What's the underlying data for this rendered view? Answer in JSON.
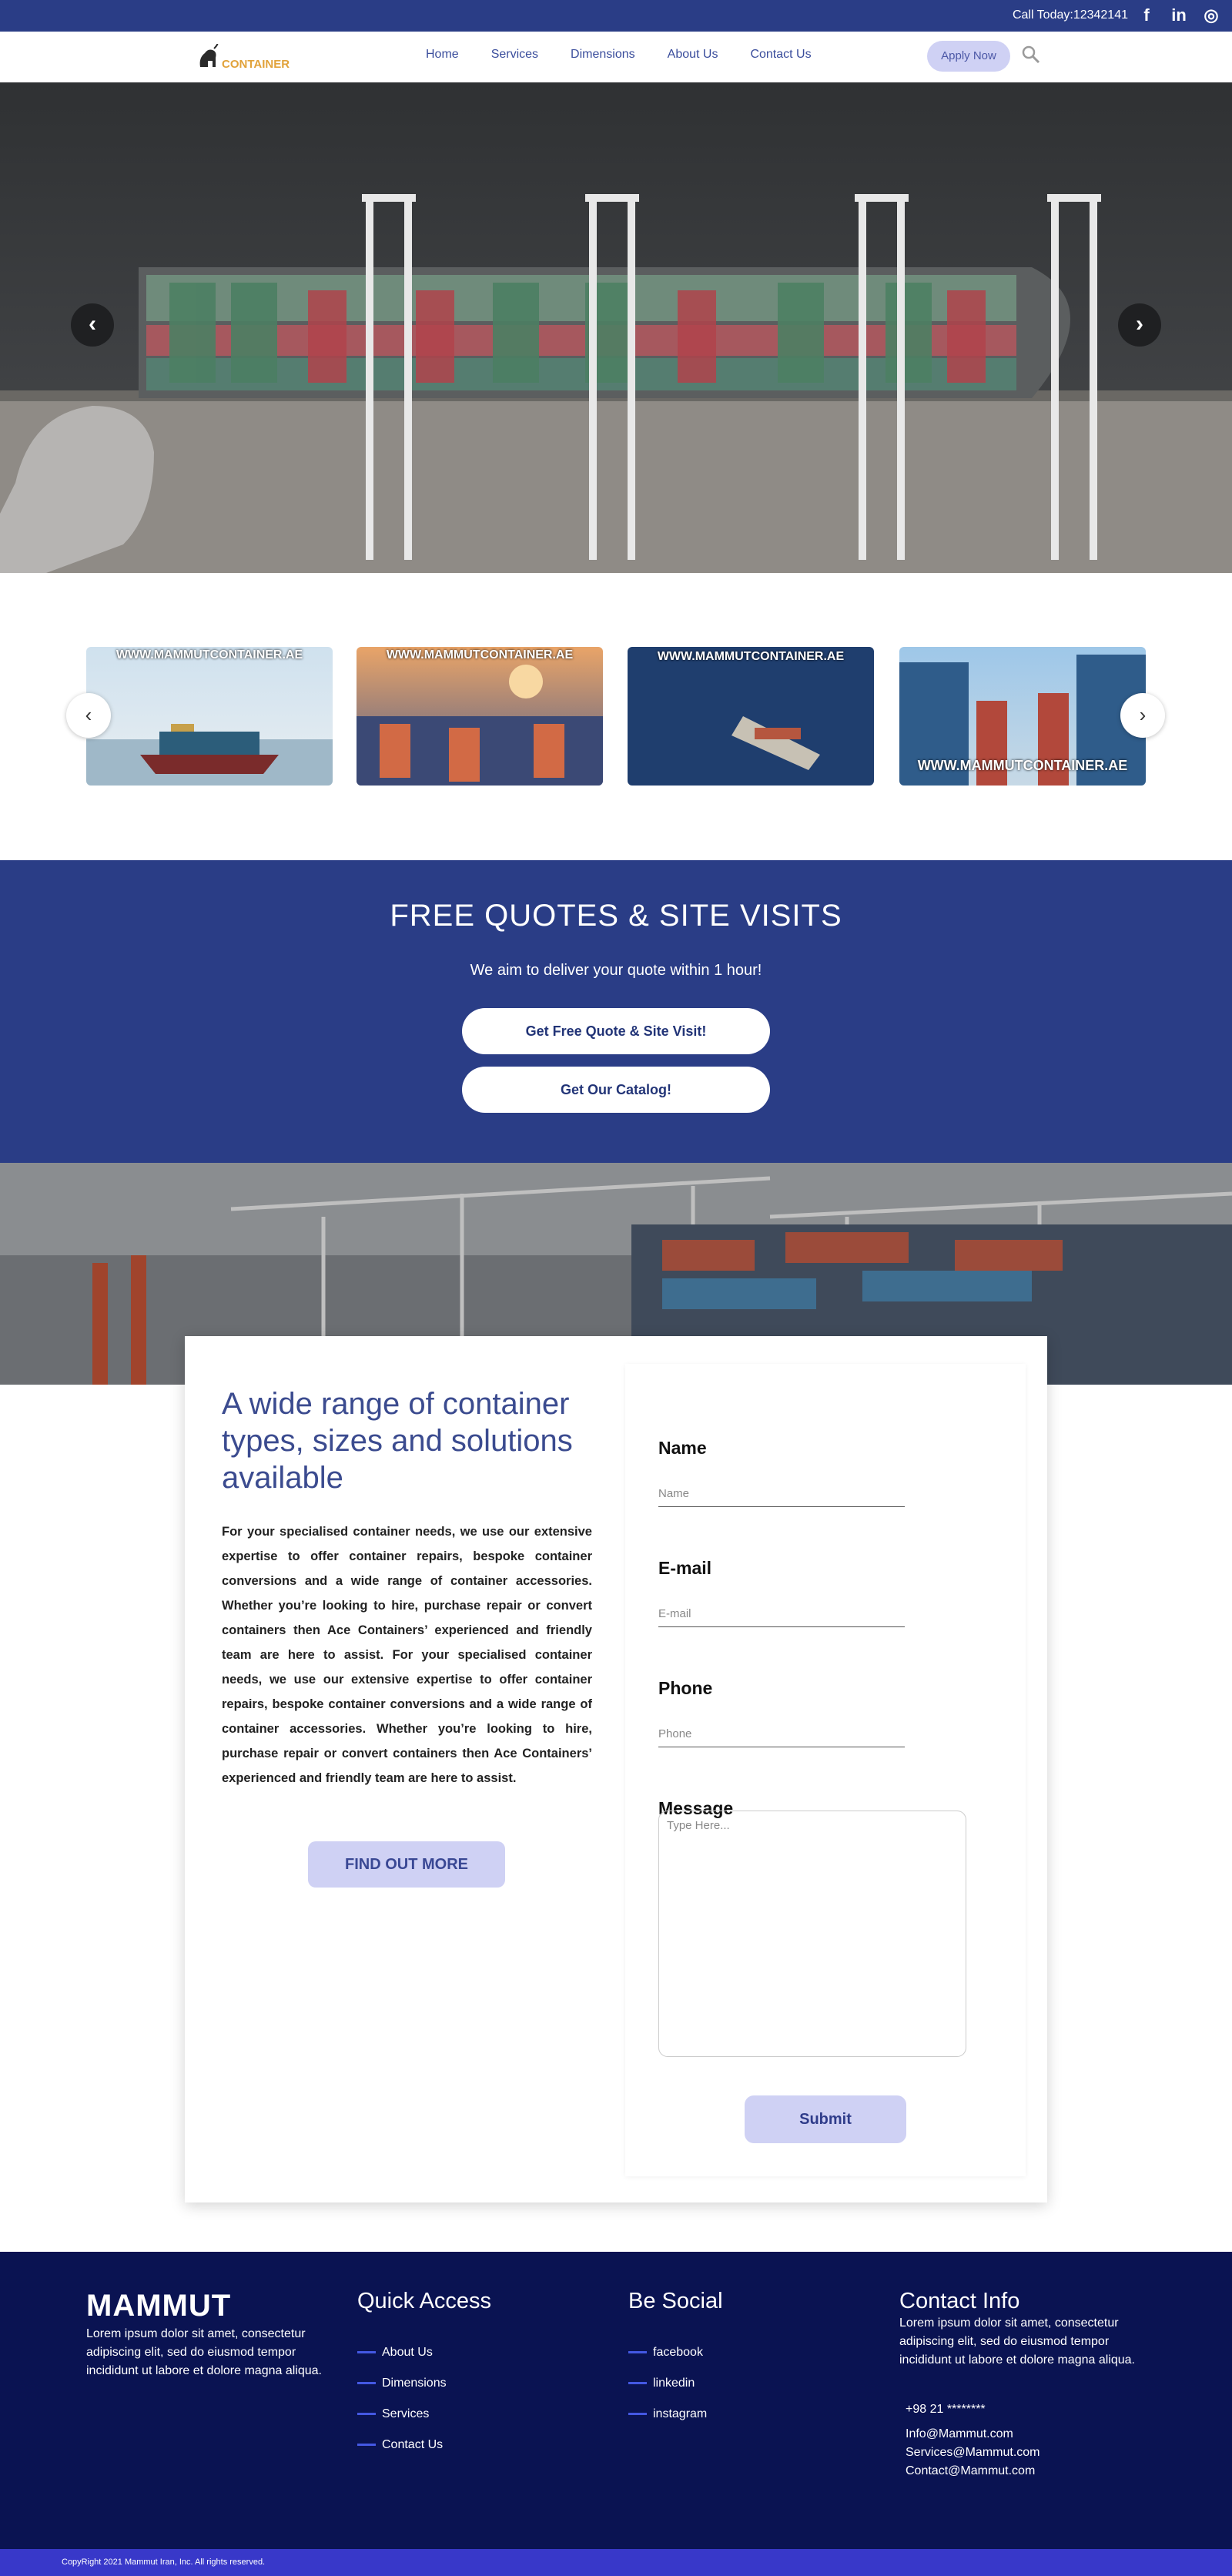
{
  "topbar": {
    "call_text": "Call Today:12342141",
    "social": [
      {
        "icon": "facebook-icon",
        "glyph": "f"
      },
      {
        "icon": "linkedin-icon",
        "glyph": "in"
      },
      {
        "icon": "instagram-icon",
        "glyph": "◎"
      }
    ]
  },
  "nav": {
    "logo_text": "CONTAINER",
    "items": [
      "Home",
      "Services",
      "Dimensions",
      "About Us",
      "Contact Us"
    ],
    "apply_label": "Apply Now",
    "search_icon": "search-icon"
  },
  "hero": {
    "prev_glyph": "‹",
    "next_glyph": "›"
  },
  "thumbs": {
    "prev_glyph": "‹",
    "next_glyph": "›",
    "items": [
      {
        "label": "WWW.MAMMUTCONTAINER.AE"
      },
      {
        "label": "WWW.MAMMUTCONTAINER.AE"
      },
      {
        "label": "WWW.MAMMUTCONTAINER.AE"
      },
      {
        "label": "WWW.MAMMUTCONTAINER.AE"
      }
    ]
  },
  "quotes": {
    "title": "FREE QUOTES & SITE VISITS",
    "subtitle": "We aim to deliver your quote within 1 hour!",
    "btn_quote": "Get Free Quote & Site Visit!",
    "btn_catalog": "Get Our Catalog!"
  },
  "about": {
    "title": "A wide range of container types, sizes and solutions available",
    "body": "For your specialised container needs, we use our extensive expertise to offer container repairs, bespoke container conversions and a wide range of container accessories. Whether you’re looking to hire, purchase repair or convert containers then Ace Containers’ experienced and friendly team are here to assist. For your specialised container needs, we use our extensive expertise to offer container repairs, bespoke container conversions and a wide range of container accessories. Whether you’re looking to hire, purchase repair or convert containers then Ace Containers’ experienced and friendly team are here to assist.",
    "cta": "FIND OUT MORE"
  },
  "form": {
    "name_label": "Name",
    "name_placeholder": "Name",
    "email_label": "E-mail",
    "email_placeholder": "E-mail",
    "phone_label": "Phone",
    "phone_placeholder": "Phone",
    "message_label": "Message",
    "message_placeholder": "Type Here...",
    "submit_label": "Submit"
  },
  "footer": {
    "brand": "MAMMUT",
    "brand_desc": "Lorem ipsum dolor sit amet, consectetur adipiscing elit, sed do eiusmod tempor incididunt ut labore et dolore magna aliqua.",
    "quick_title": "Quick Access",
    "quick_links": [
      "About Us",
      "Dimensions",
      "Services",
      "Contact Us"
    ],
    "social_title": "Be Social",
    "social_links": [
      "facebook",
      "linkedin",
      "instagram"
    ],
    "contact_title": "Contact Info",
    "contact_desc": "Lorem ipsum dolor sit amet, consectetur adipiscing elit, sed do eiusmod tempor incididunt ut labore et dolore magna aliqua.",
    "phone": "+98 21 ********",
    "emails": [
      "Info@Mammut.com",
      "Services@Mammut.com",
      "Contact@Mammut.com"
    ],
    "copyright": "CopyRight 2021 Mammut Iran, Inc. All rights reserved."
  },
  "colors": {
    "primary": "#2a3d86",
    "footer": "#0a1352",
    "copyright_bar": "#3838c9",
    "accent_soft": "#cfd1f4",
    "logo_orange": "#e1a23a"
  }
}
